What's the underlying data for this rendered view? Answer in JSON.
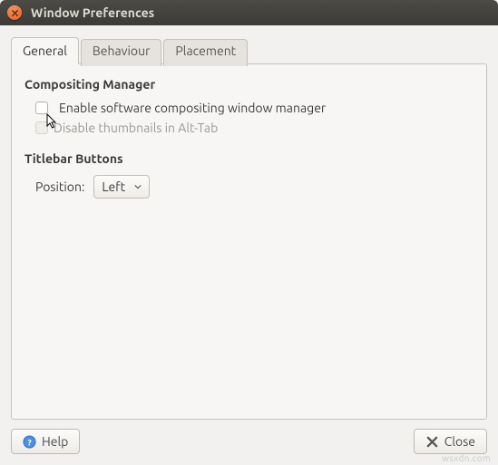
{
  "window": {
    "title": "Window Preferences"
  },
  "tabs": {
    "general": "General",
    "behaviour": "Behaviour",
    "placement": "Placement"
  },
  "general": {
    "compositing": {
      "heading": "Compositing Manager",
      "enable_label": "Enable software compositing window manager",
      "disable_thumbs_label": "Disable thumbnails in Alt-Tab"
    },
    "titlebar_buttons": {
      "heading": "Titlebar Buttons",
      "position_label": "Position:",
      "position_value": "Left"
    }
  },
  "footer": {
    "help": "Help",
    "close": "Close"
  },
  "watermark": "wsxdn.com"
}
